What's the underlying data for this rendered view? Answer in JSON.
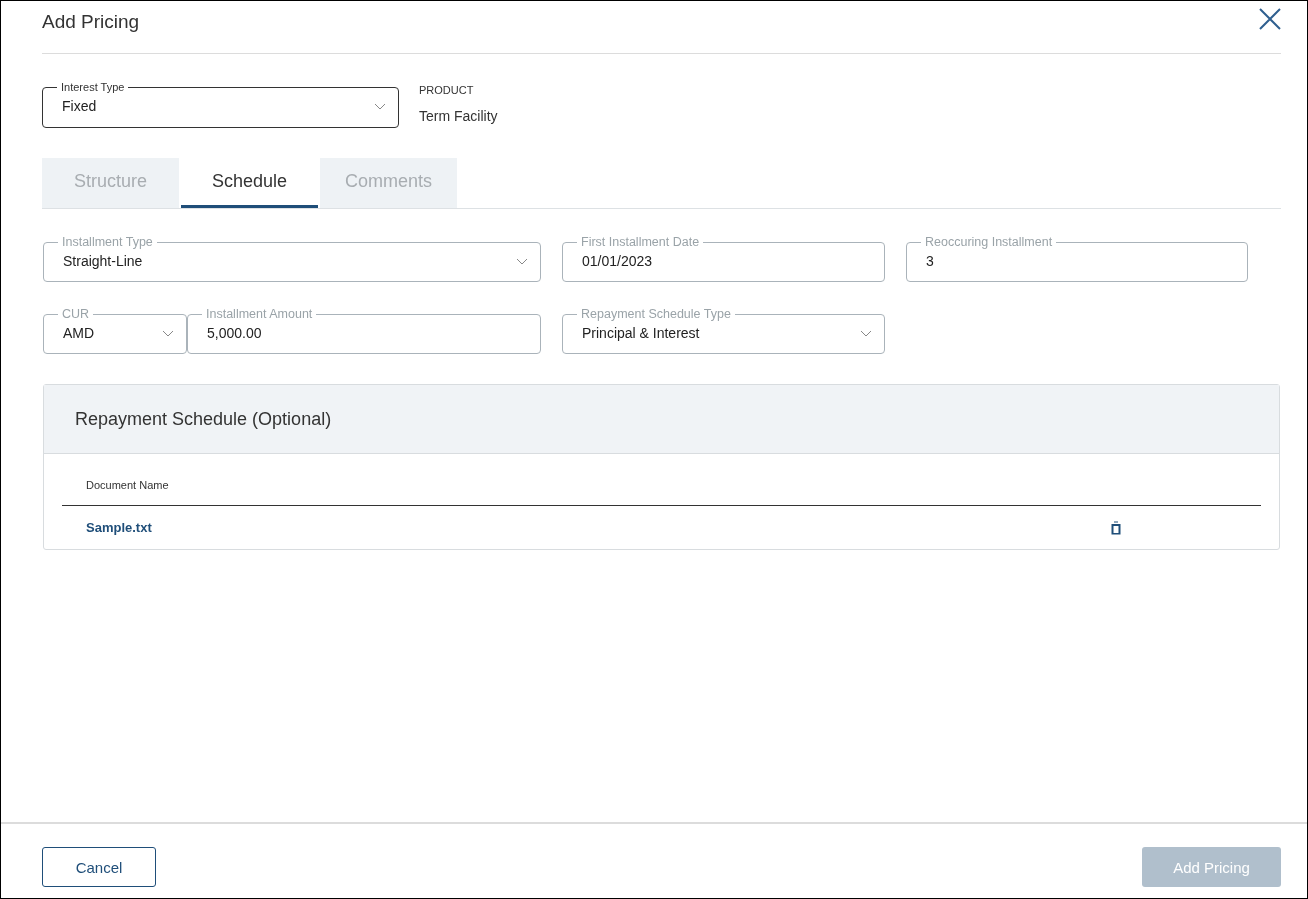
{
  "dialog": {
    "title": "Add Pricing"
  },
  "interest_type": {
    "label": "Interest Type",
    "value": "Fixed",
    "kind": "select",
    "focused": true
  },
  "product": {
    "label": "PRODUCT",
    "value": "Term Facility"
  },
  "tabs": [
    {
      "label": "Structure",
      "selected": false
    },
    {
      "label": "Schedule",
      "selected": true
    },
    {
      "label": "Comments",
      "selected": false
    }
  ],
  "field_rows": [
    [
      {
        "label": "Installment Type",
        "value": "Straight-Line",
        "kind": "select"
      },
      {
        "label": "First Installment Date",
        "value": "01/01/2023",
        "kind": "text"
      },
      {
        "label": "Reoccuring Installment",
        "value": "3",
        "kind": "text"
      }
    ],
    [
      {
        "label": "CUR",
        "value": "AMD",
        "kind": "select"
      },
      {
        "label": "Installment Amount",
        "value": "5,000.00",
        "kind": "text"
      },
      {
        "label": "Repayment Schedule Type",
        "value": "Principal & Interest",
        "kind": "select"
      }
    ]
  ],
  "repayment_schedule": {
    "title": "Repayment Schedule (Optional)",
    "columns": [
      "Document Name"
    ],
    "rows": [
      {
        "name": "Sample.txt"
      }
    ]
  },
  "buttons": [
    {
      "label": "Cancel",
      "kind": "secondary",
      "disabled": false
    },
    {
      "label": "Add Pricing",
      "kind": "primary",
      "disabled": true
    }
  ]
}
